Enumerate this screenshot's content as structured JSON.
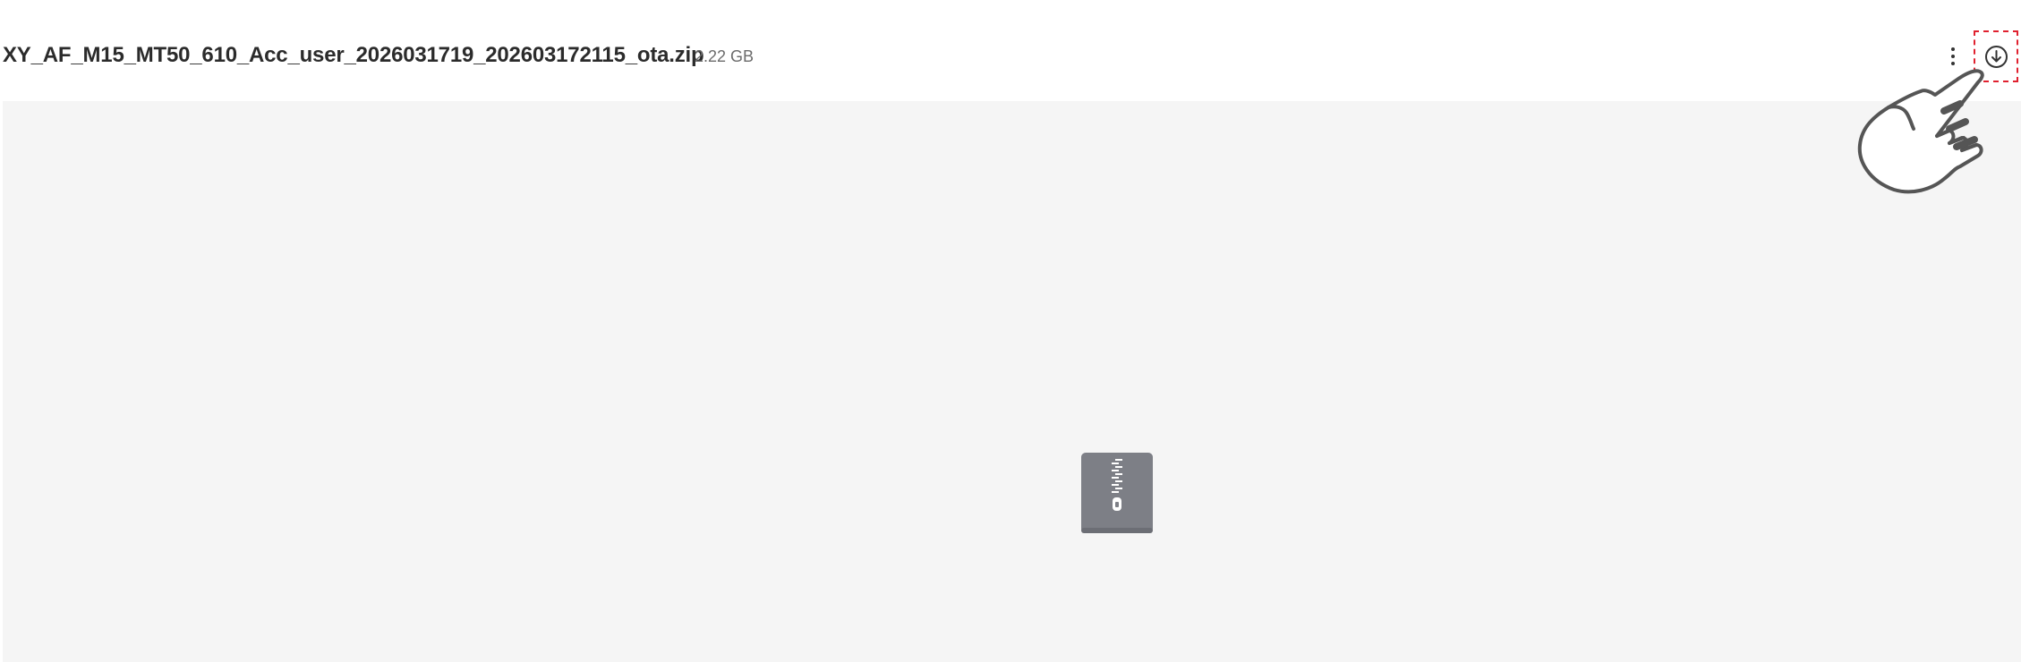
{
  "file": {
    "name": "XY_AF_M15_MT50_610_Acc_user_2026031719_202603172115_ota.zip",
    "size": "2.22 GB",
    "type_icon": "zip-file-icon"
  },
  "actions": {
    "more_icon": "more-vertical-icon",
    "download_icon": "download-circle-icon",
    "highlight_color": "#e0212f"
  },
  "overlay": {
    "pointer_icon": "pointing-hand-icon"
  },
  "colors": {
    "preview_background": "#f5f5f5",
    "zip_icon": "#7d7f86"
  }
}
